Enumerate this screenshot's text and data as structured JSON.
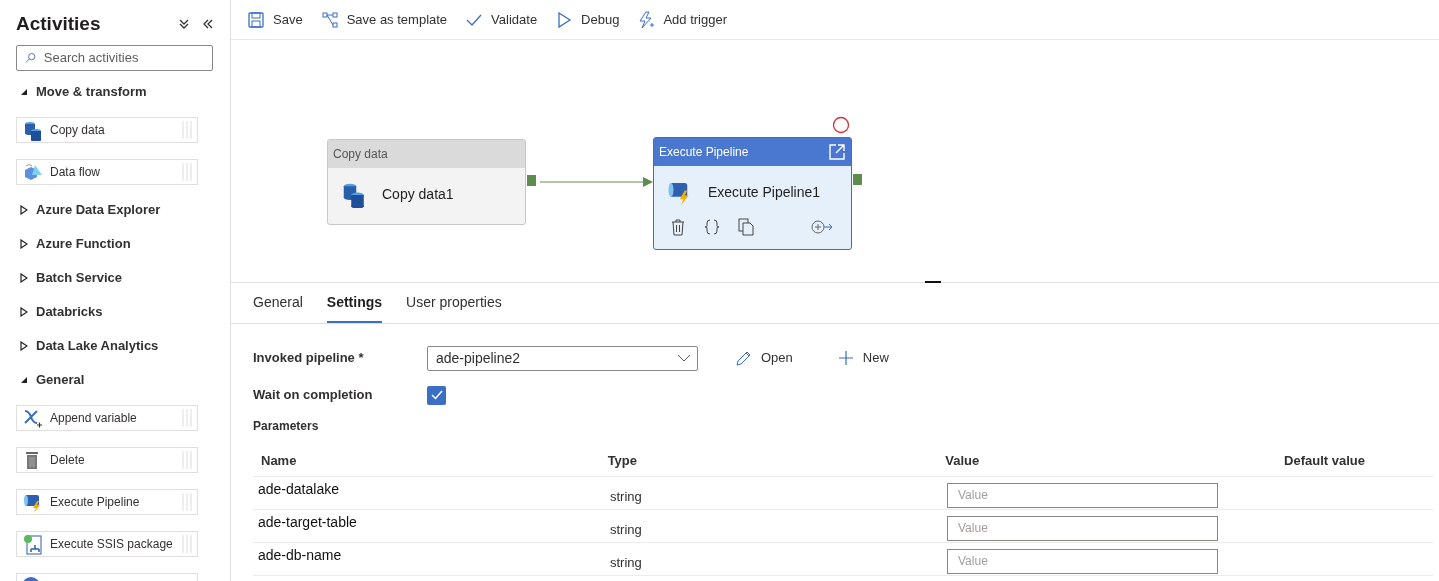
{
  "sidebar": {
    "title": "Activities",
    "search": {
      "placeholder": "Search activities"
    },
    "groups": [
      {
        "label": "Move & transform",
        "expanded": true,
        "children": [
          {
            "label": "Copy data"
          },
          {
            "label": "Data flow"
          }
        ]
      },
      {
        "label": "Azure Data Explorer",
        "expanded": false
      },
      {
        "label": "Azure Function",
        "expanded": false
      },
      {
        "label": "Batch Service",
        "expanded": false
      },
      {
        "label": "Databricks",
        "expanded": false
      },
      {
        "label": "Data Lake Analytics",
        "expanded": false
      },
      {
        "label": "General",
        "expanded": true,
        "children": [
          {
            "label": "Append variable"
          },
          {
            "label": "Delete"
          },
          {
            "label": "Execute Pipeline"
          },
          {
            "label": "Execute SSIS package"
          },
          {
            "kind": "cut"
          }
        ]
      }
    ]
  },
  "toolbar": [
    "Save",
    "Save as template",
    "Validate",
    "Debug",
    "Add trigger"
  ],
  "canvas": {
    "nodes": [
      {
        "type": "Copy data",
        "name": "Copy data1",
        "selected": false
      },
      {
        "type": "Execute Pipeline",
        "name": "Execute Pipeline1",
        "selected": true
      }
    ]
  },
  "tabs": [
    {
      "label": "General",
      "selected": false
    },
    {
      "label": "Settings",
      "selected": true
    },
    {
      "label": "User properties",
      "selected": false
    }
  ],
  "settings": {
    "invoked_pipeline": {
      "label": "Invoked pipeline",
      "required_mark": "*",
      "value": "ade-pipeline2"
    },
    "actions": [
      "Open",
      "New"
    ],
    "wait_on_completion": {
      "label": "Wait on completion",
      "checked": true
    },
    "parameters": {
      "title": "Parameters",
      "columns": [
        "Name",
        "Type",
        "Value",
        "Default value"
      ],
      "rows": [
        {
          "name": "ade-datalake",
          "type": "string",
          "value_placeholder": "Value"
        },
        {
          "name": "ade-target-table",
          "type": "string",
          "value_placeholder": "Value"
        },
        {
          "name": "ade-db-name",
          "type": "string",
          "value_placeholder": "Value"
        }
      ]
    }
  }
}
